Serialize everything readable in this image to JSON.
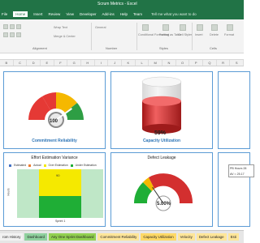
{
  "window": {
    "title": "Scrum Metrics  -  Excel"
  },
  "menu": {
    "items": [
      "File",
      "Home",
      "Insert",
      "Review",
      "View",
      "Developer",
      "Add-ins",
      "Help",
      "Team"
    ],
    "tell_me": "Tell me what you want to do"
  },
  "ribbon": {
    "groups": {
      "alignment": "Alignment",
      "number": "Number",
      "styles": "Styles",
      "cells": "Cells"
    },
    "buttons": {
      "wrap_text": "Wrap Text",
      "merge_center": "Merge & Center",
      "general": "General",
      "conditional_formatting": "Conditional Formatting",
      "format_as_table": "Format as Table",
      "cell_styles": "Cell Styles",
      "insert": "Insert",
      "delete": "Delete",
      "format": "Format"
    }
  },
  "columns": [
    "B",
    "C",
    "D",
    "E",
    "F",
    "G",
    "H",
    "I",
    "J",
    "K",
    "L",
    "M",
    "N",
    "O",
    "P",
    "Q",
    "R",
    "S"
  ],
  "panels": {
    "commitment": {
      "title": "Commitment Reliability",
      "value": "100",
      "level": 0.8
    },
    "capacity": {
      "title": "Capacity Utilization",
      "value": "59%",
      "level": 0.59
    },
    "effort": {
      "title": "Effort Estimation Variance",
      "legend": [
        "Estimated",
        "Actual",
        "Over Estimation",
        "Under Estimation"
      ],
      "y_label": "Hours",
      "x_label": "Sprint 1",
      "bar_value": "90"
    },
    "leakage": {
      "title": "Defect Leakage",
      "value": "5.00%",
      "level": 0.05
    },
    "side": {
      "line1": "PB Hours 28",
      "line2": "AV = 25.17"
    }
  },
  "colors": {
    "excel_green": "#217346",
    "gauge_red": "#e53935",
    "gauge_yellow": "#f5b800",
    "gauge_green": "#2e9e44",
    "bar_yellow": "#f5e900",
    "bar_green": "#1fae36",
    "bar_bg": "#bfe7c7"
  },
  "tabs": [
    {
      "label": "rom History",
      "color": "#f2f2f2"
    },
    {
      "label": "Dashboard",
      "color": "#8fd19e"
    },
    {
      "label": "Any One Sprint Dashboard",
      "color": "#92d050"
    },
    {
      "label": "Commitment Reliability",
      "color": "#ffe699"
    },
    {
      "label": "Capacity Utilization",
      "color": "#ffd966"
    },
    {
      "label": "Velocity",
      "color": "#ffe699"
    },
    {
      "label": "Defect Leakage",
      "color": "#ffe699"
    },
    {
      "label": "Esti",
      "color": "#ffe699"
    }
  ]
}
